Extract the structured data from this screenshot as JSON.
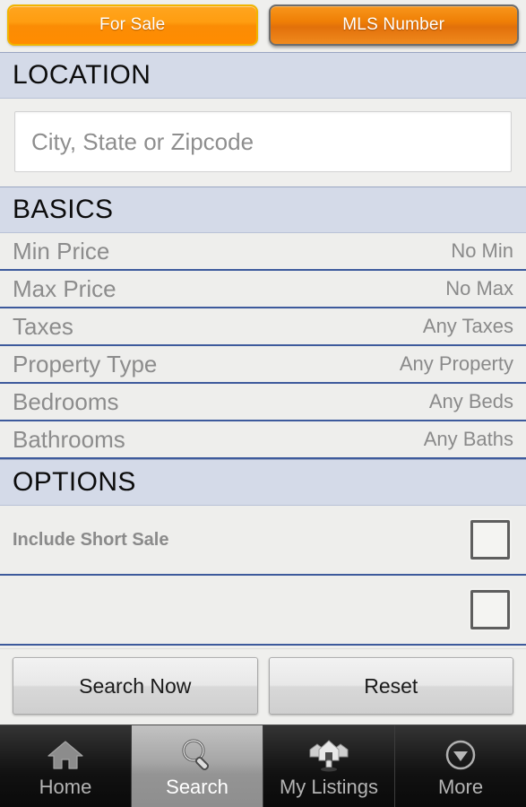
{
  "toggle": {
    "options": [
      {
        "label": "For Sale",
        "selected": true
      },
      {
        "label": "MLS Number",
        "selected": false
      }
    ]
  },
  "sections": {
    "location": {
      "header": "LOCATION",
      "input_placeholder": "City, State or Zipcode",
      "input_value": ""
    },
    "basics": {
      "header": "BASICS",
      "rows": [
        {
          "label": "Min Price",
          "value": "No Min"
        },
        {
          "label": "Max Price",
          "value": "No Max"
        },
        {
          "label": "Taxes",
          "value": "Any Taxes"
        },
        {
          "label": "Property Type",
          "value": "Any Property"
        },
        {
          "label": "Bedrooms",
          "value": "Any Beds"
        },
        {
          "label": "Bathrooms",
          "value": "Any Baths"
        }
      ]
    },
    "options": {
      "header": "OPTIONS",
      "rows": [
        {
          "label": "Include Short Sale",
          "checked": false
        },
        {
          "label": "",
          "checked": false
        }
      ]
    }
  },
  "actions": {
    "search": "Search Now",
    "reset": "Reset"
  },
  "tabs": [
    {
      "label": "Home",
      "icon": "home-icon",
      "active": false
    },
    {
      "label": "Search",
      "icon": "search-icon",
      "active": true
    },
    {
      "label": "My Listings",
      "icon": "houses-icon",
      "active": false
    },
    {
      "label": "More",
      "icon": "chevron-down-circle-icon",
      "active": false
    }
  ],
  "colors": {
    "accent_orange": "#ff8c00",
    "selected_border": "#f0b400",
    "section_header_bg": "#d4dae8",
    "row_divider": "#3d5a9c",
    "body_bg": "#efefed",
    "tabbar_bg": "#111111"
  }
}
